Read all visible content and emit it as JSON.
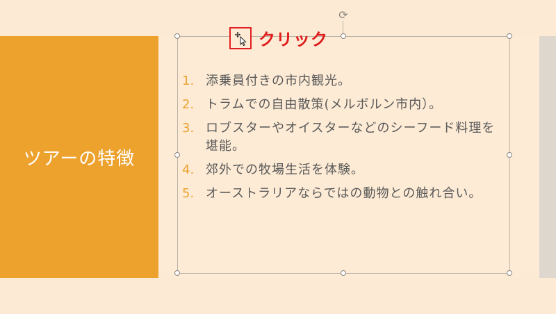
{
  "slide": {
    "title": "ツアーの特徴",
    "items": [
      {
        "number": "1.",
        "text": "添乗員付きの市内観光。"
      },
      {
        "number": "2.",
        "text": "トラムでの自由散策(メルボルン市内）。"
      },
      {
        "number": "3.",
        "text": "ロブスターやオイスターなどのシーフード料理を堪能。"
      },
      {
        "number": "4.",
        "text": "郊外での牧場生活を体験。"
      },
      {
        "number": "5.",
        "text": "オーストラリアならではの動物との触れ合い。"
      }
    ]
  },
  "annotation": {
    "click_label": "クリック",
    "cursor_icon": "move-cursor-icon"
  },
  "colors": {
    "accent": "#eda22e",
    "background": "#fdebd5",
    "annotation_red": "#e01b1b",
    "text": "#595959"
  }
}
